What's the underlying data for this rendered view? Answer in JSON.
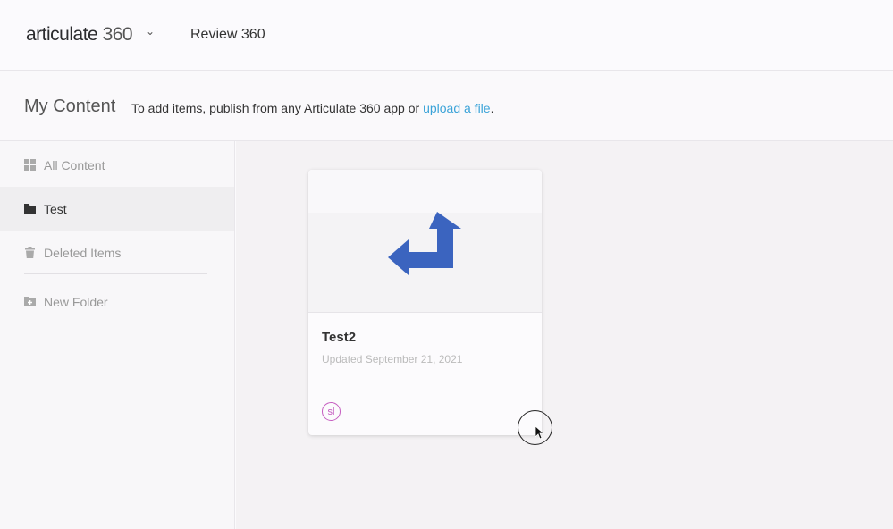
{
  "topbar": {
    "logo_word": "articulate",
    "logo_num": "360",
    "app_name": "Review 360"
  },
  "header": {
    "title": "My Content",
    "hint_prefix": "To add items, publish from any Articulate 360 app or ",
    "hint_link": "upload a file",
    "hint_suffix": "."
  },
  "sidebar": {
    "items": [
      {
        "label": "All Content"
      },
      {
        "label": "Test"
      },
      {
        "label": "Deleted Items"
      },
      {
        "label": "New Folder"
      }
    ]
  },
  "card": {
    "title": "Test2",
    "updated": "Updated September 21, 2021",
    "avatar": "sl",
    "arrow_color": "#3b64bf"
  }
}
